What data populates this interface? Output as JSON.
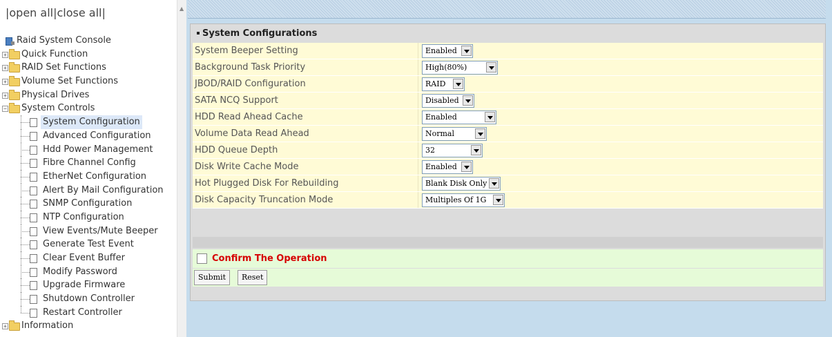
{
  "nav": {
    "open_all": "open all",
    "close_all": "close all",
    "sep1": "|",
    "sep2": "|",
    "sep3": "|"
  },
  "tree": {
    "root": "Raid System Console",
    "folders": [
      "Quick Function",
      "RAID Set Functions",
      "Volume Set Functions",
      "Physical Drives"
    ],
    "system_controls": "System Controls",
    "children": [
      "System Configuration",
      "Advanced Configuration",
      "Hdd Power Management",
      "Fibre Channel Config",
      "EtherNet Configuration",
      "Alert By Mail Configuration",
      "SNMP Configuration",
      "NTP Configuration",
      "View Events/Mute Beeper",
      "Generate Test Event",
      "Clear Event Buffer",
      "Modify Password",
      "Upgrade Firmware",
      "Shutdown Controller",
      "Restart Controller"
    ],
    "selected_child": "System Configuration",
    "last_folder": "Information"
  },
  "panel": {
    "title": "System Configurations",
    "rows": [
      {
        "label": "System Beeper Setting",
        "value": "Enabled"
      },
      {
        "label": "Background Task Priority",
        "value": "High(80%)"
      },
      {
        "label": "JBOD/RAID Configuration",
        "value": "RAID"
      },
      {
        "label": "SATA NCQ Support",
        "value": "Disabled"
      },
      {
        "label": "HDD Read Ahead Cache",
        "value": "Enabled"
      },
      {
        "label": "Volume Data Read Ahead",
        "value": "Normal"
      },
      {
        "label": "HDD Queue Depth",
        "value": "32"
      },
      {
        "label": "Disk Write Cache Mode",
        "value": "Enabled"
      },
      {
        "label": "Hot Plugged Disk For Rebuilding",
        "value": "Blank Disk Only"
      },
      {
        "label": "Disk Capacity Truncation Mode",
        "value": "Multiples Of 1G"
      }
    ],
    "confirm_label": "Confirm The Operation",
    "submit_label": "Submit",
    "reset_label": "Reset"
  },
  "colors": {
    "row_bg": "#fffbd6",
    "confirm_bg": "#e6fbd8",
    "confirm_text": "#d60000",
    "frame_bg": "#c5dced"
  }
}
